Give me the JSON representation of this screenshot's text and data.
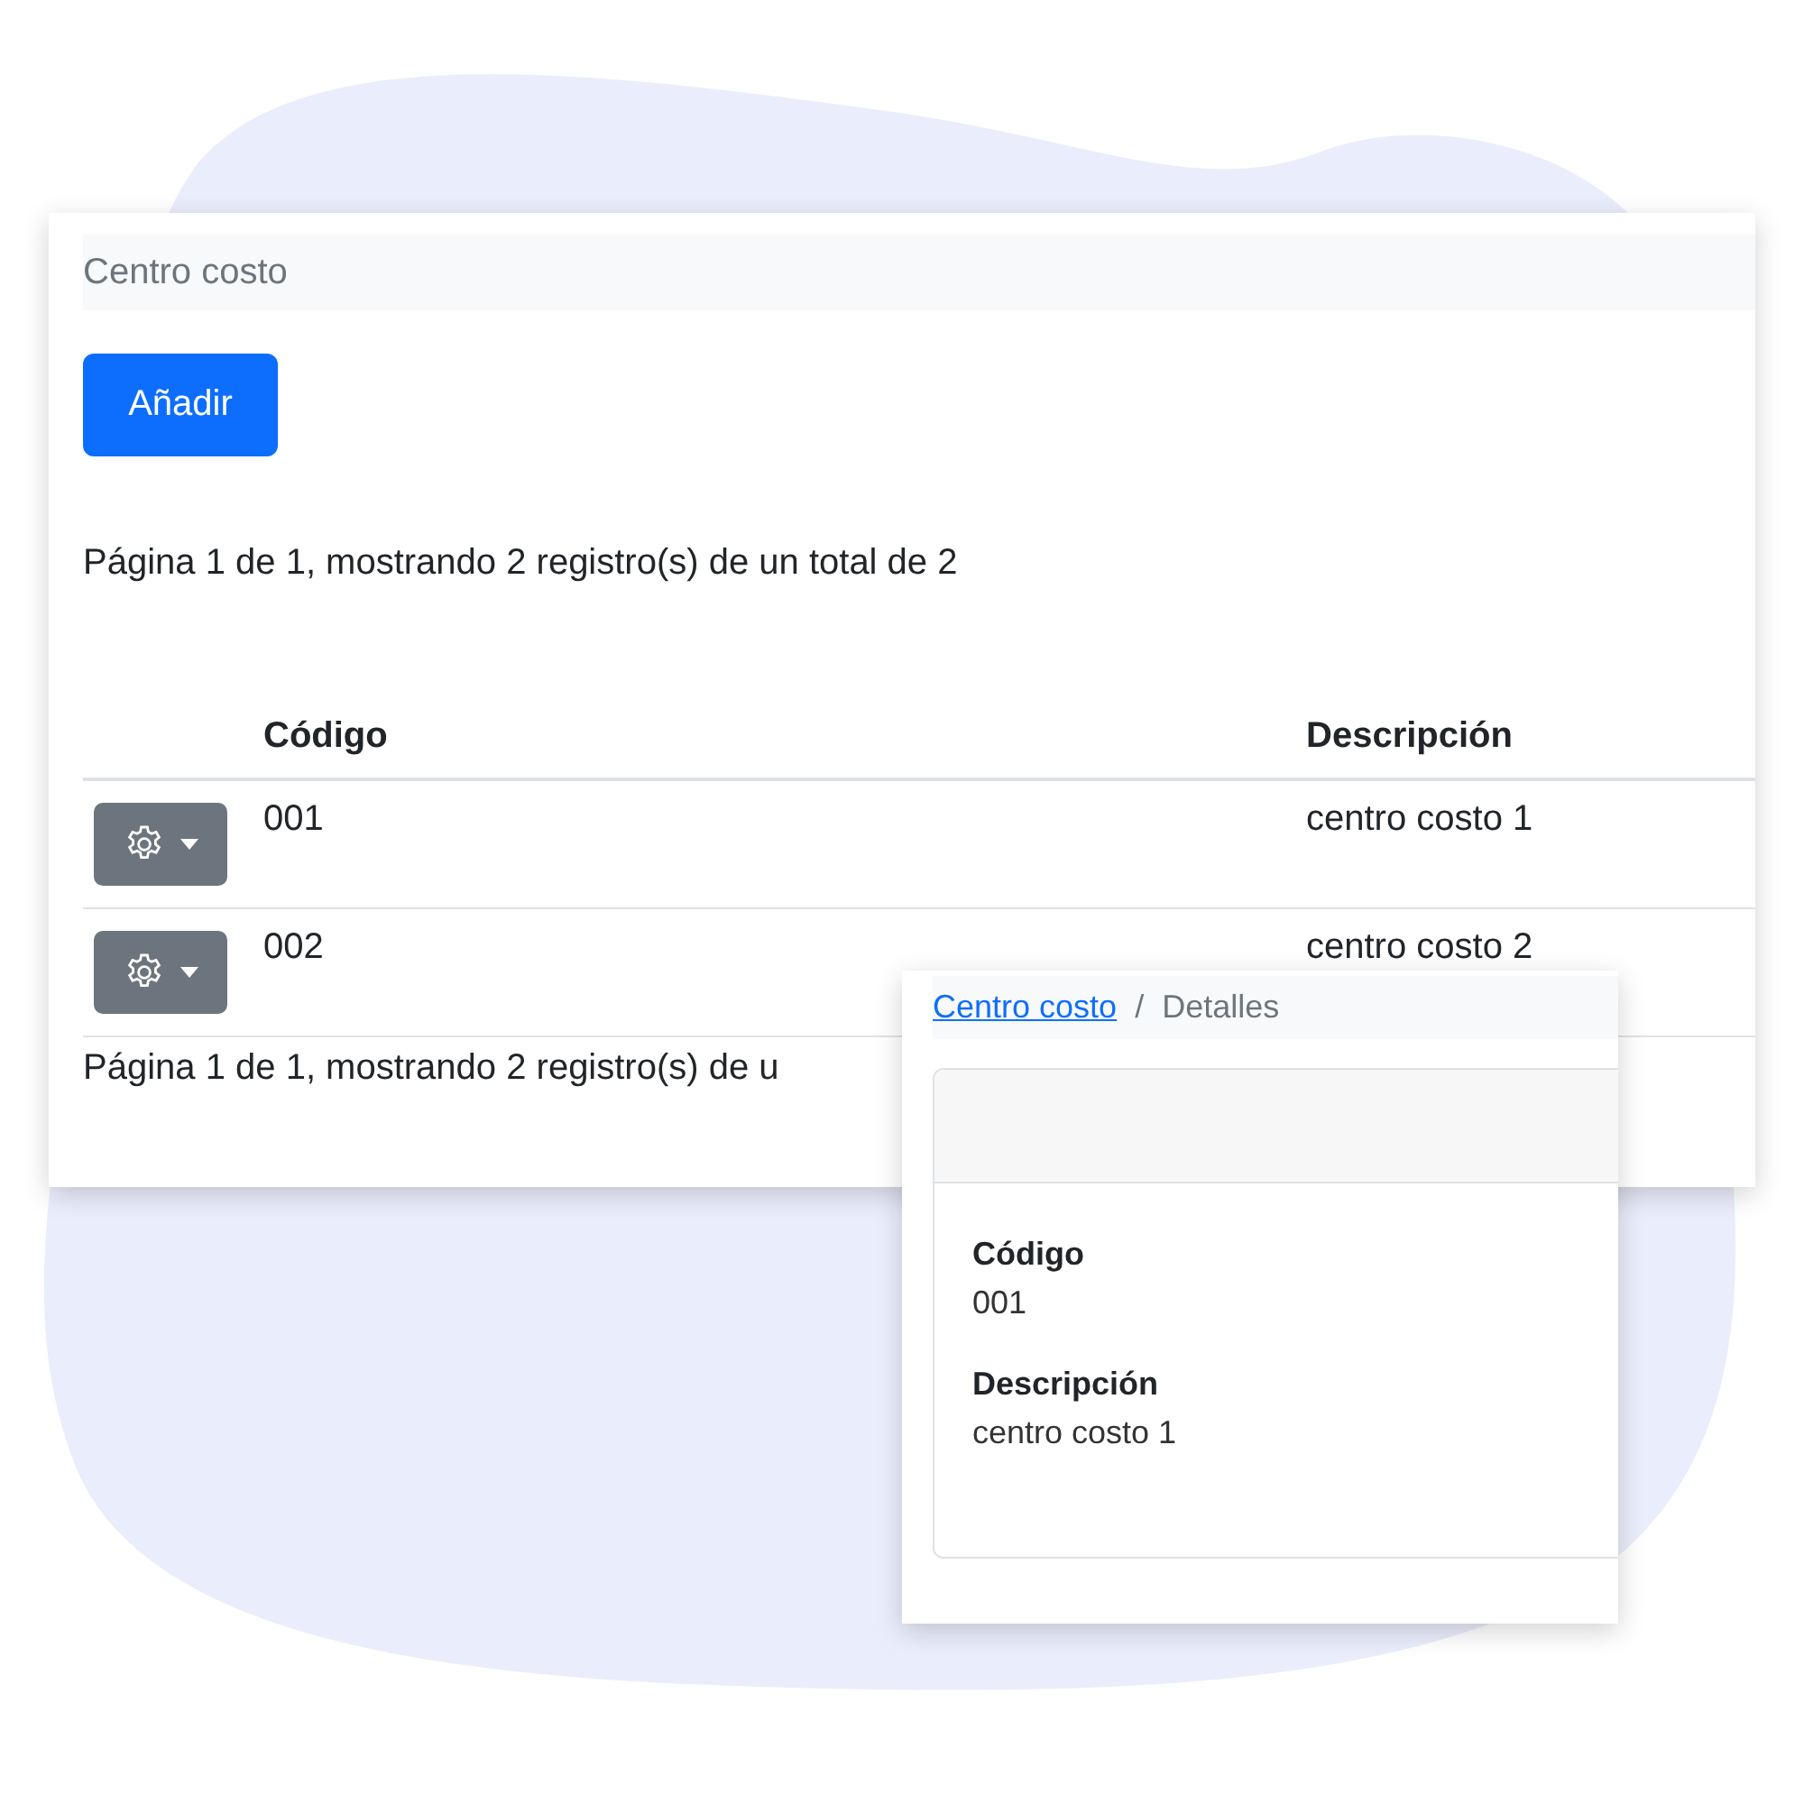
{
  "main_panel": {
    "header": "Centro costo",
    "add_button": "Añadir",
    "paging_top": "Página 1 de 1, mostrando 2 registro(s) de un total de 2",
    "table": {
      "columns": [
        "Código",
        "Descripción"
      ],
      "rows": [
        {
          "code": "001",
          "description": "centro costo 1"
        },
        {
          "code": "002",
          "description": "centro costo 2"
        }
      ]
    },
    "paging_bottom": "Página 1 de 1, mostrando 2 registro(s) de u"
  },
  "detail_panel": {
    "breadcrumb": [
      {
        "label": "Centro costo",
        "kind": "link"
      },
      {
        "label": "/",
        "kind": "separator"
      },
      {
        "label": "Detalles",
        "kind": "current"
      }
    ],
    "fields": [
      {
        "label": "Código",
        "value": "001"
      },
      {
        "label": "Descripción",
        "value": "centro costo 1"
      }
    ]
  }
}
